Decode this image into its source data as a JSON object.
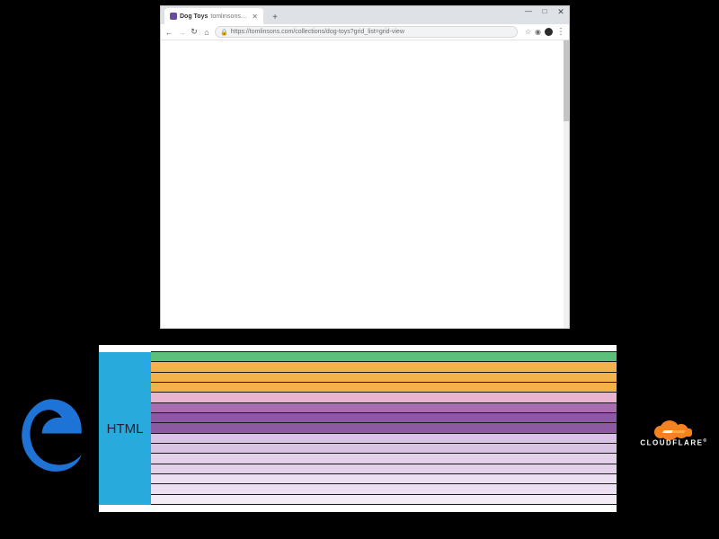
{
  "browser": {
    "window_controls": {
      "minimize": "—",
      "maximize": "□",
      "close": "✕"
    },
    "tab": {
      "favicon_color": "#6b4ba1",
      "title": "Dog Toys",
      "subtitle": "tomlinsons-feed",
      "close": "✕"
    },
    "new_tab": "+",
    "nav": {
      "back": "←",
      "forward": "→",
      "reload": "↻",
      "home": "⌂"
    },
    "omnibox": {
      "lock": "🔒",
      "url": "https://tomlinsons.com/collections/dog-toys?grid_list=grid-view"
    },
    "right_icons": {
      "star": "☆",
      "ext": "◉",
      "menu": "⋮"
    }
  },
  "diagram": {
    "root_label": "HTML",
    "rows": [
      {
        "color": "#5cbf7a"
      },
      {
        "color": "#f4b24a"
      },
      {
        "color": "#f4b24a"
      },
      {
        "color": "#f4b24a"
      },
      {
        "color": "#e8b4cf"
      },
      {
        "color": "#a86fb0"
      },
      {
        "color": "#8b5aa3"
      },
      {
        "color": "#8b5aa3"
      },
      {
        "color": "#d9c3e2"
      },
      {
        "color": "#d9c3e2"
      },
      {
        "color": "#e3d1ea"
      },
      {
        "color": "#e3d1ea"
      },
      {
        "color": "#ecdff1"
      },
      {
        "color": "#ecdff1"
      },
      {
        "color": "#f3ecf6"
      }
    ]
  },
  "logos": {
    "edge_name": "Microsoft Edge",
    "cloudflare_text": "CLOUDFLARE",
    "registered": "®"
  }
}
